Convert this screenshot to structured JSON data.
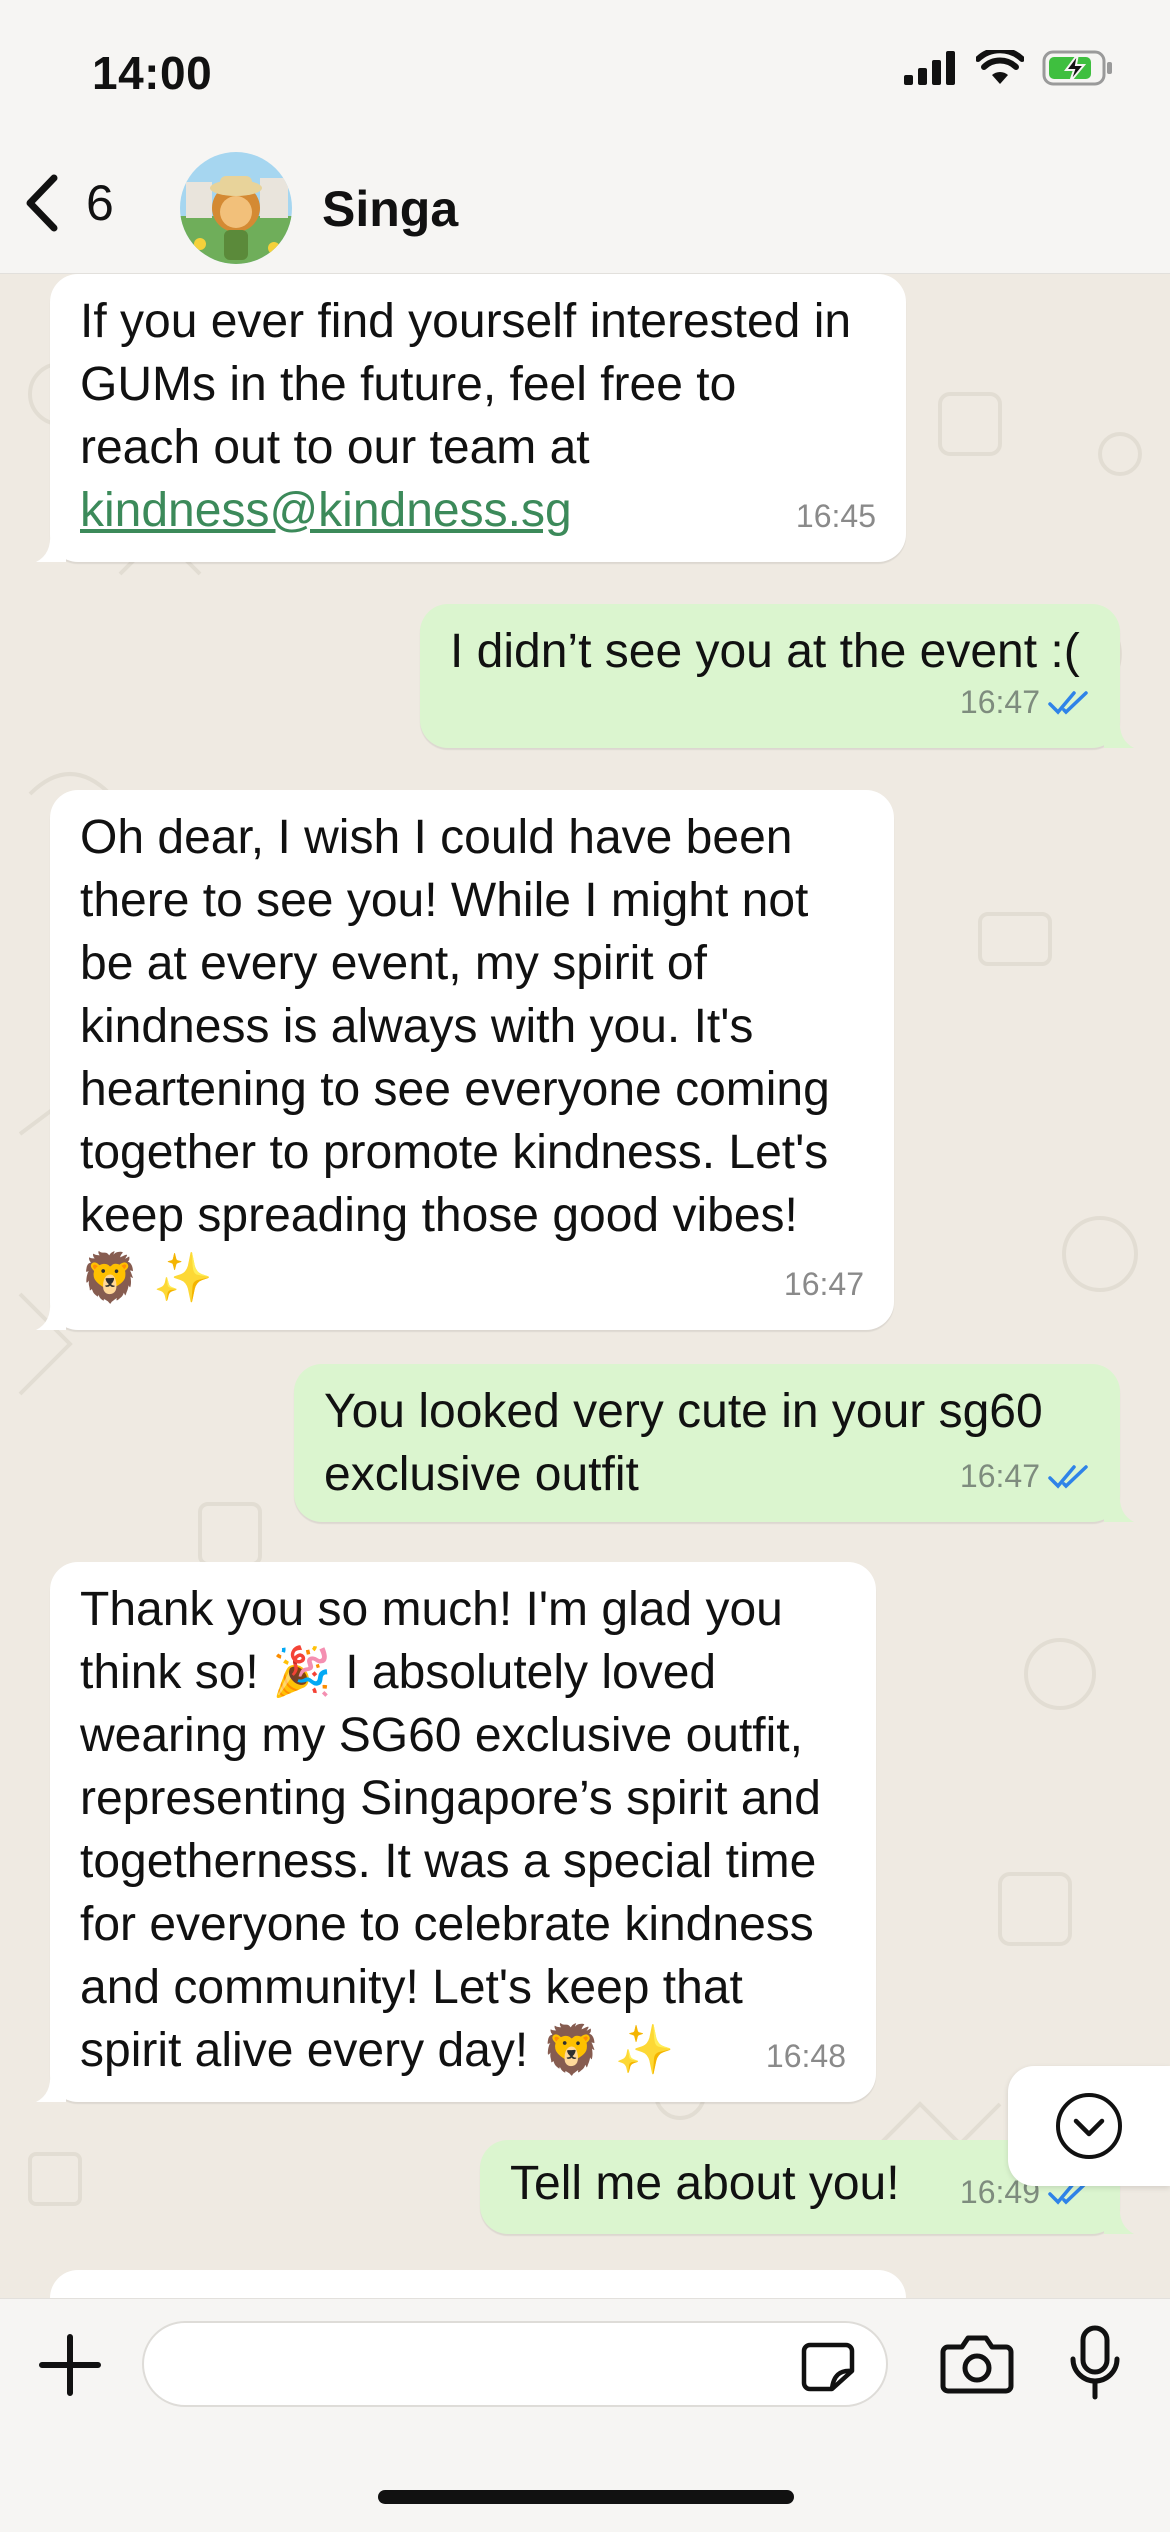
{
  "status_bar": {
    "time": "14:00"
  },
  "header": {
    "back_count": "6",
    "contact_name": "Singa"
  },
  "messages": [
    {
      "direction": "incoming",
      "text_before_link": "If you ever find yourself interested in\nGUMs in the future, feel free to\nreach out to our team at\n",
      "link": "kindness@kindness.sg",
      "time": "16:45"
    },
    {
      "direction": "outgoing",
      "text": "I didn’t see you at the event :(",
      "time": "16:47",
      "status": "read"
    },
    {
      "direction": "incoming",
      "text": "Oh dear, I wish I could have been\nthere to see you! While I might not\nbe at every event, my spirit of\nkindness is always with you. It's\nheartening to see everyone coming\ntogether to promote kindness. Let's\nkeep spreading those good vibes!\n🦁 ✨",
      "time": "16:47"
    },
    {
      "direction": "outgoing",
      "text": "You looked very cute in your sg60\nexclusive outfit",
      "time": "16:47",
      "status": "read"
    },
    {
      "direction": "incoming",
      "text": "Thank you so much! I'm glad you\nthink so! 🎉 I absolutely loved\nwearing my SG60 exclusive outfit,\nrepresenting Singapore’s spirit and\ntogetherness. It was a special time\nfor everyone to celebrate kindness\nand community! Let's keep that\nspirit alive every day! 🦁 ✨",
      "time": "16:48"
    },
    {
      "direction": "outgoing",
      "text": "Tell me about you!",
      "time": "16:49",
      "status": "read"
    }
  ],
  "composer": {
    "placeholder": "",
    "value": ""
  },
  "icons": {
    "back": "chevron-left-icon",
    "scroll_down": "chevron-down-circle-icon",
    "plus": "plus-icon",
    "sticker": "sticker-icon",
    "camera": "camera-icon",
    "mic": "microphone-icon",
    "read_receipt": "double-check-icon"
  },
  "colors": {
    "incoming_bubble": "#ffffff",
    "outgoing_bubble": "#dbf5cf",
    "read_tick": "#2f83e8",
    "link": "#3c8a5a",
    "chat_background": "#efeae2",
    "battery": "#3fbf3f"
  }
}
